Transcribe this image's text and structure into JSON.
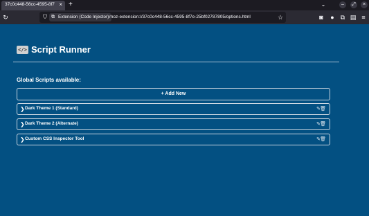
{
  "browser": {
    "tab_title": "37c0c448-56cc-4595-8f7e-2",
    "tab_close": "×",
    "new_tab": "+",
    "identity_label": "Extension (Code Injector)",
    "url": "moz-extension://37c0c448-56cc-4595-8f7e-25bf02787805/options.html"
  },
  "page": {
    "logo_text": "</>",
    "title": "Script Runner",
    "section_label": "Global Scripts available:",
    "add_button_label": "+ Add New",
    "scripts": [
      {
        "name": "Dark Theme 1 (Standard)"
      },
      {
        "name": "Dark Theme 2 (Alternate)"
      },
      {
        "name": "Custom CSS Inspector Tool"
      }
    ]
  }
}
